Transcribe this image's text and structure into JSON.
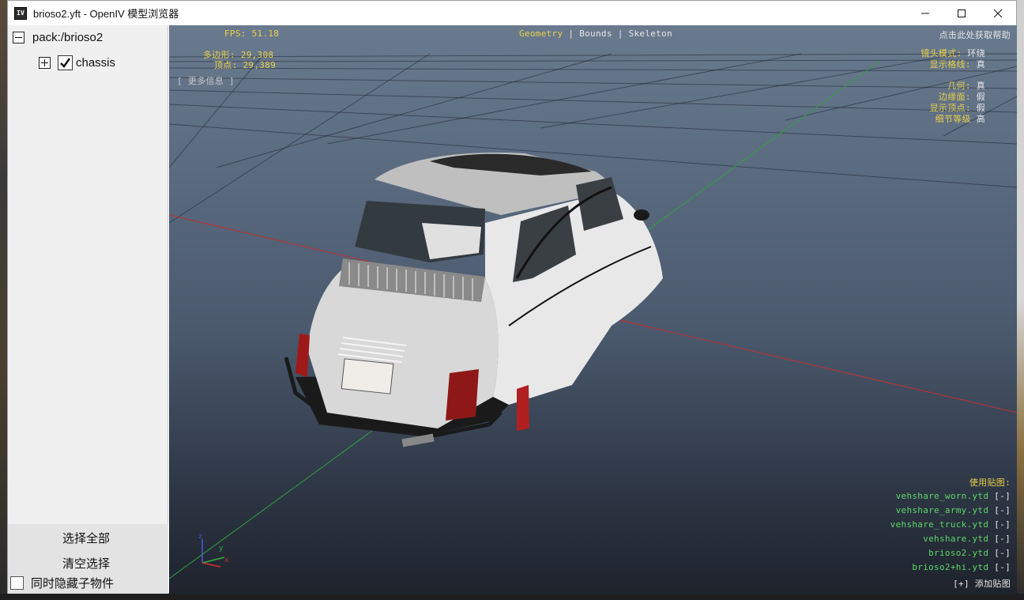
{
  "window": {
    "title": "brioso2.yft - OpenIV 模型浏览器",
    "app_icon_text": "IV"
  },
  "tree": {
    "root_label": "pack:/brioso2",
    "child_label": "chassis"
  },
  "panel": {
    "select_all": "选择全部",
    "clear_selection": "清空选择",
    "hide_children_label": "同时隐藏子物件"
  },
  "hud": {
    "fps": "FPS: 51.18",
    "polygons_label": "多边形:",
    "polygons_value": "29,308",
    "vertices_label": "顶点:",
    "vertices_value": "29,389",
    "more_info": "[ 更多信息 ]",
    "tabs": {
      "geometry": "Geometry",
      "bounds": "Bounds",
      "skeleton": "Skeleton",
      "separator": "|"
    },
    "help": "点击此处获取帮助",
    "camera_mode_label": "镜头模式:",
    "camera_mode_value": "环绕",
    "show_grid_label": "显示格线:",
    "show_grid_value": "真",
    "geometry_label": "几何:",
    "geometry_value": "真",
    "edges_label": "边缘面:",
    "edges_value": "假",
    "show_vertices_label": "显示顶点:",
    "show_vertices_value": "假",
    "lod_label": "细节等级",
    "lod_value": "高",
    "textures_used": "使用贴图:",
    "textures": [
      "vehshare_worn.ytd",
      "vehshare_army.ytd",
      "vehshare_truck.ytd",
      "vehshare.ytd",
      "brioso2.ytd",
      "brioso2+hi.ytd"
    ],
    "remove_toggle": "[-]",
    "add_texture": "[+] 添加贴图",
    "axis_x": "x",
    "axis_y": "y",
    "axis_z": "z"
  },
  "colors": {
    "hud_yellow": "#e8d04a",
    "hud_green": "#5cd66a",
    "axis_red": "#d03030",
    "axis_green": "#30b040"
  }
}
